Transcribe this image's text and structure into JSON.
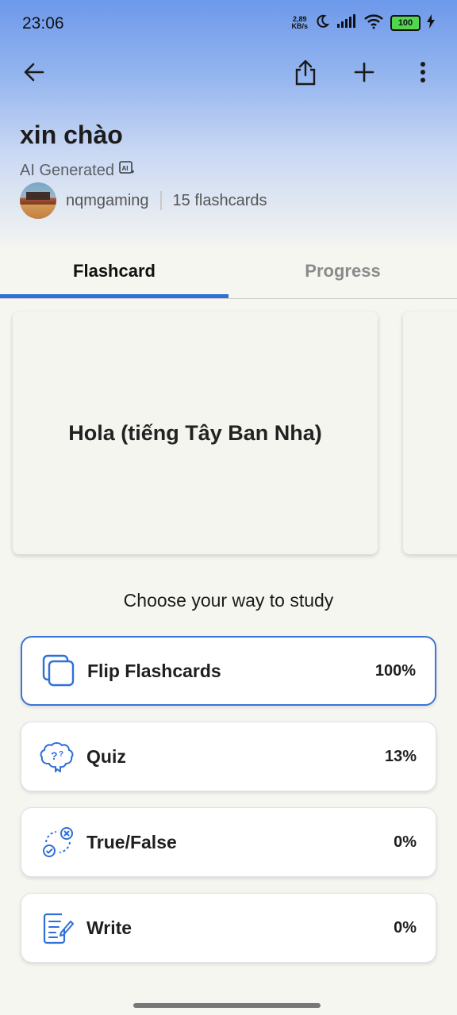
{
  "status_bar": {
    "time": "23:06",
    "speed_value": "2,89",
    "speed_unit": "KB/s",
    "battery": "100",
    "icons": [
      "moon-icon",
      "signal-icon",
      "wifi-icon",
      "battery-icon",
      "charging-icon"
    ]
  },
  "toolbar": {
    "back_icon": "arrow-left-icon",
    "share_icon": "share-icon",
    "add_icon": "plus-icon",
    "more_icon": "more-vertical-icon"
  },
  "deck": {
    "title": "xin chào",
    "subtitle": "AI Generated",
    "owner": "nqmgaming",
    "count": "15 flashcards"
  },
  "tabs": [
    {
      "label": "Flashcard",
      "active": true
    },
    {
      "label": "Progress",
      "active": false
    }
  ],
  "card": {
    "front_text": "Hola (tiếng Tây Ban Nha)"
  },
  "study": {
    "heading": "Choose your way to study",
    "modes": [
      {
        "label": "Flip Flashcards",
        "percent": "100%",
        "icon": "flashcards-icon",
        "selected": true
      },
      {
        "label": "Quiz",
        "percent": "13%",
        "icon": "brain-question-icon",
        "selected": false
      },
      {
        "label": "True/False",
        "percent": "0%",
        "icon": "true-false-icon",
        "selected": false
      },
      {
        "label": "Write",
        "percent": "0%",
        "icon": "write-icon",
        "selected": false
      }
    ]
  },
  "colors": {
    "accent": "#2f6fd9",
    "header_top": "#6d99ea",
    "background": "#f6f6f1"
  }
}
